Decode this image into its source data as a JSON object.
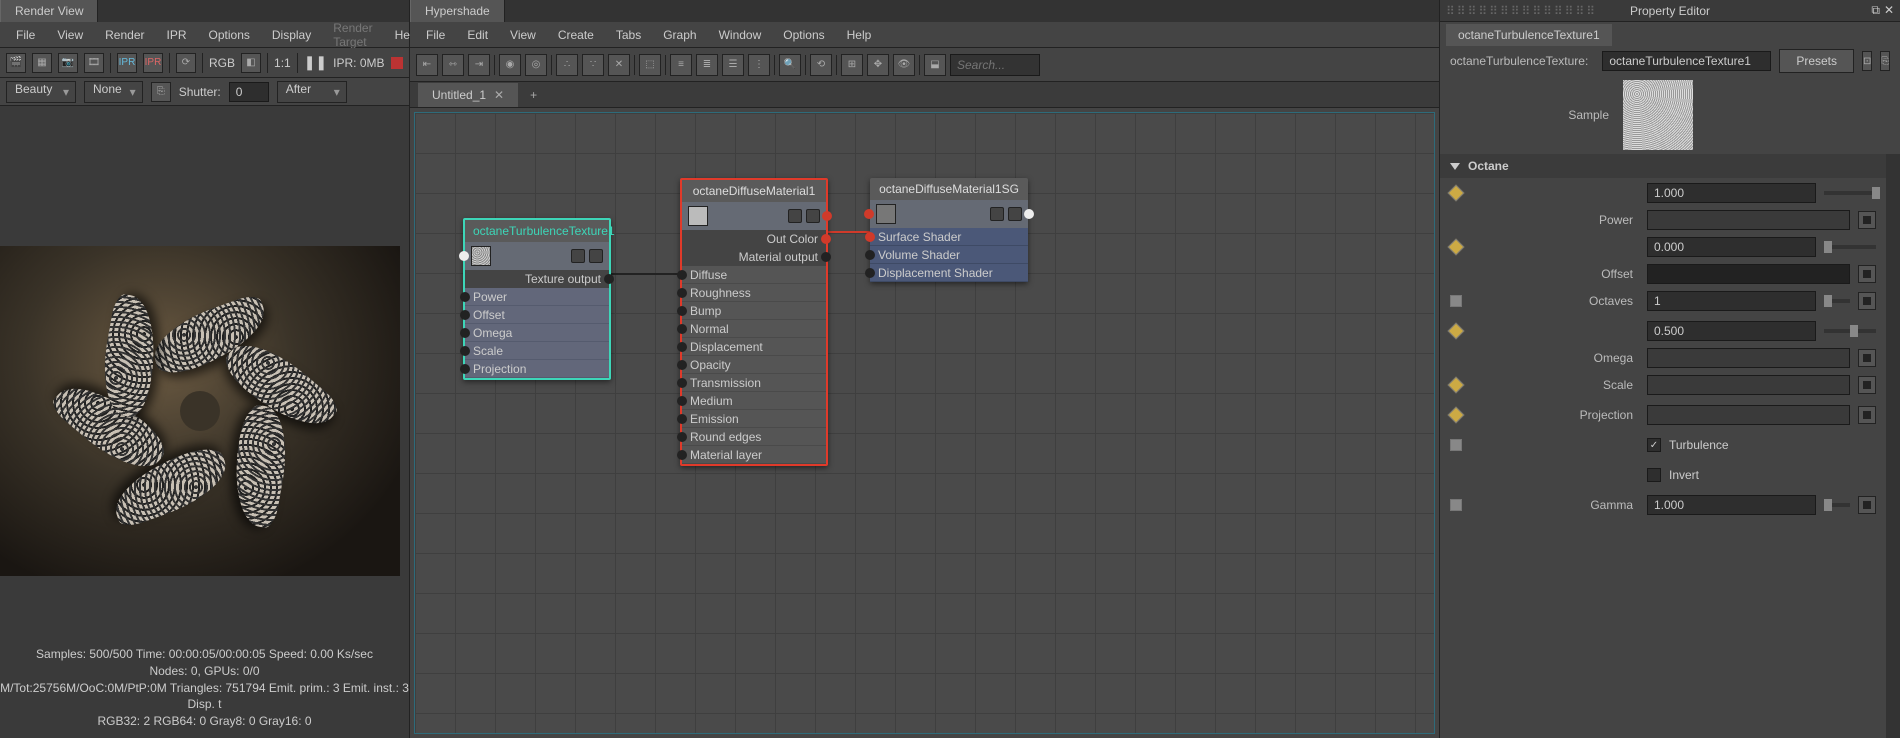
{
  "renderView": {
    "tab": "Render View",
    "menu": [
      "File",
      "View",
      "Render",
      "IPR",
      "Options",
      "Display",
      "Render Target",
      "Help"
    ],
    "menuDisabledIndex": 6,
    "rgbLabel": "RGB",
    "ratio": "1:1",
    "iprStatus": "IPR: 0MB",
    "beauty": "Beauty",
    "noneDropdown": "None",
    "shutterLabel": "Shutter:",
    "shutterValue": "0",
    "afterDropdown": "After",
    "stats": {
      "l1": "Samples: 500/500 Time: 00:00:05/00:00:05 Speed: 0.00 Ks/sec",
      "l2": "Nodes: 0, GPUs: 0/0",
      "l3": "M/Tot:25756M/OoC:0M/PtP:0M Triangles: 751794 Emit. prim.: 3 Emit. inst.: 3 Disp. t",
      "l4": "RGB32: 2 RGB64: 0 Gray8: 0 Gray16: 0"
    }
  },
  "hypershade": {
    "tab": "Hypershade",
    "menu": [
      "File",
      "Edit",
      "View",
      "Create",
      "Tabs",
      "Graph",
      "Window",
      "Options",
      "Help"
    ],
    "searchPlaceholder": "Search...",
    "graphTab": "Untitled_1",
    "node1": {
      "title": "octaneTurbulenceTexture1",
      "out": "Texture output",
      "attrs": [
        "Power",
        "Offset",
        "Omega",
        "Scale",
        "Projection"
      ]
    },
    "node2": {
      "title": "octaneDiffuseMaterial1",
      "outColor": "Out Color",
      "out": "Material output",
      "attrs": [
        "Diffuse",
        "Roughness",
        "Bump",
        "Normal",
        "Displacement",
        "Opacity",
        "Transmission",
        "Medium",
        "Emission",
        "Round edges",
        "Material layer"
      ]
    },
    "node3": {
      "title": "octaneDiffuseMaterial1SG",
      "attrs": [
        "Surface Shader",
        "Volume Shader",
        "Displacement Shader"
      ]
    }
  },
  "propertyEditor": {
    "title": "Property Editor",
    "tab": "octaneTurbulenceTexture1",
    "typeLabel": "octaneTurbulenceTexture:",
    "nameValue": "octaneTurbulenceTexture1",
    "presetsBtn": "Presets",
    "sampleLabel": "Sample",
    "section": "Octane",
    "props": {
      "power": {
        "label": "Power",
        "value": "1.000",
        "thumb": 100
      },
      "offset": {
        "label": "Offset",
        "value": "0.000",
        "thumb": 0
      },
      "octaves": {
        "label": "Octaves",
        "value": "1",
        "thumb": 0
      },
      "omega": {
        "label": "Omega",
        "value": "0.500",
        "thumb": 50
      },
      "scale": {
        "label": "Scale"
      },
      "projection": {
        "label": "Projection"
      },
      "turbulence": {
        "label": "Turbulence",
        "checked": true
      },
      "invert": {
        "label": "Invert",
        "checked": false
      },
      "gamma": {
        "label": "Gamma",
        "value": "1.000",
        "thumb": 0
      }
    }
  }
}
